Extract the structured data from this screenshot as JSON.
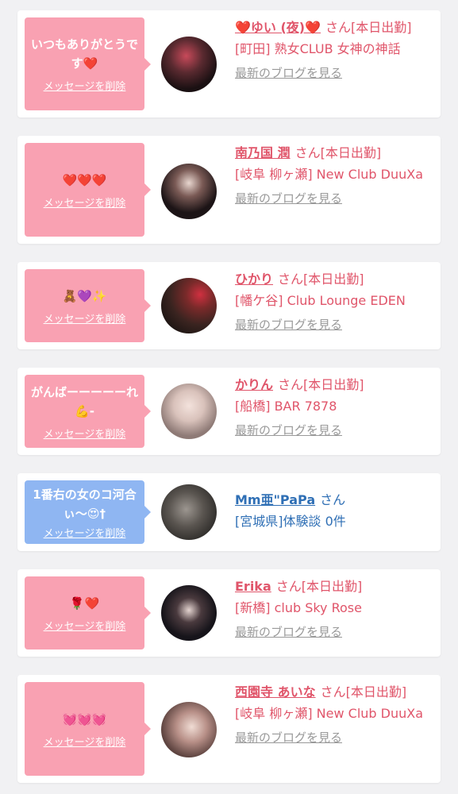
{
  "delete_label": "メッセージを削除",
  "blog_label": "最新のブログを見る",
  "colors": {
    "pink": "#f9a1b2",
    "blue": "#8fb6f2",
    "name_pink": "#e0556a",
    "name_blue": "#2f6fb5"
  },
  "entries": [
    {
      "message": "いつもありがとうです❤️",
      "name": "❤️ゆい (夜)❤️",
      "suffix": "さん[本日出勤]",
      "shop": "[町田] 熟女CLUB 女神の神話",
      "blog": "最新のブログを見る"
    },
    {
      "message": "❤️❤️❤️",
      "name": "南乃国 潤",
      "suffix": "さん[本日出勤]",
      "shop": "[岐阜 柳ヶ瀬] New Club DuuXa",
      "blog": "最新のブログを見る"
    },
    {
      "message": "🧸💜✨",
      "name": "ひかり",
      "suffix": "さん[本日出勤]",
      "shop": "[幡ケ谷] Club Lounge EDEN",
      "blog": "最新のブログを見る"
    },
    {
      "message": "がんばーーーーーれ💪-",
      "name": "かりん",
      "suffix": "さん[本日出勤]",
      "shop": "[船橋] BAR 7878",
      "blog": "最新のブログを見る"
    },
    {
      "message": "1番右の女のコ河合ぃ〜😍†",
      "name": "Mm亜\"PaPa",
      "suffix": "さん",
      "shop": "[宮城県]体験談 0件"
    },
    {
      "message": "🌹❤️",
      "name": "Erika",
      "suffix": "さん[本日出勤]",
      "shop": "[新橋] club Sky Rose",
      "blog": "最新のブログを見る"
    },
    {
      "message": "💓💓💓",
      "name": "西園寺 あいな",
      "suffix": "さん[本日出勤]",
      "shop": "[岐阜 柳ヶ瀬] New Club DuuXa",
      "blog": "最新のブログを見る"
    }
  ]
}
